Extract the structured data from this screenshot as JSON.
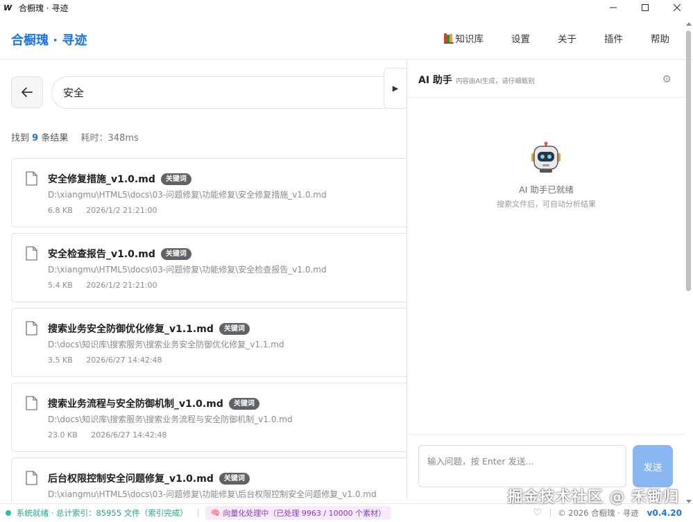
{
  "window": {
    "title": "合橱瑰 · 寻迹",
    "logo_letter": "W"
  },
  "header": {
    "brand": "合橱瑰 · 寻迹",
    "nav": [
      {
        "label": "知识库",
        "icon": "books-icon"
      },
      {
        "label": "设置"
      },
      {
        "label": "关于"
      },
      {
        "label": "插件"
      },
      {
        "label": "帮助"
      }
    ]
  },
  "search": {
    "value": "安全",
    "placeholder": ""
  },
  "summary": {
    "prefix": "找到",
    "count": "9",
    "suffix": "条结果",
    "time": "耗时：348ms"
  },
  "results": [
    {
      "title": "安全修复措施_v1.0.md",
      "tag": "关键词",
      "path": "D:\\xiangmu\\HTML5\\docs\\03-问题修复\\功能修复\\安全修复措施_v1.0.md",
      "size": "6.8 KB",
      "date": "2026/1/2 21:21:00"
    },
    {
      "title": "安全检查报告_v1.0.md",
      "tag": "关键词",
      "path": "D:\\xiangmu\\HTML5\\docs\\03-问题修复\\功能修复\\安全检查报告_v1.0.md",
      "size": "5.4 KB",
      "date": "2026/1/2 21:21:00"
    },
    {
      "title": "搜索业务安全防御优化修复_v1.1.md",
      "tag": "关键词",
      "path": "D:\\docs\\知识库\\搜索服务\\搜索业务安全防御优化修复_v1.1.md",
      "size": "3.5 KB",
      "date": "2026/6/27 14:42:48"
    },
    {
      "title": "搜索业务流程与安全防御机制_v1.0.md",
      "tag": "关键词",
      "path": "D:\\docs\\知识库\\搜索服务\\搜索业务流程与安全防御机制_v1.0.md",
      "size": "23.0 KB",
      "date": "2026/6/27 14:42:48"
    },
    {
      "title": "后台权限控制安全问题修复_v1.0.md",
      "tag": "关键词",
      "path": "D:\\xiangmu\\HTML5\\docs\\03-问题修复\\功能修复\\后台权限控制安全问题修复_v1.0.md",
      "size": "",
      "date": ""
    }
  ],
  "ai": {
    "title": "AI 助手",
    "subtitle": "内容由AI生成，请仔细甄别",
    "ready": "AI 助手已就绪",
    "hint": "搜索文件后，可自动分析结果",
    "input_placeholder": "输入问题，按 Enter 发送...",
    "send": "发送"
  },
  "status": {
    "system": "系统就绪 · 总计索引：85955 文件（索引完成）",
    "vector": "向量化处理中（已处理 9963 / 10000 个素材）",
    "copyright": "© 2026 合橱瑰 · 寻迹",
    "version": "v0.4.20"
  },
  "watermark": "掘金技术社区 @ 禾锄归",
  "colors": {
    "accent": "#1a73e8",
    "status_green": "#1fa88f",
    "vector_purple": "#8a3fb8",
    "send_button": "#8ab7f2",
    "tag_bg": "#5f6368"
  }
}
